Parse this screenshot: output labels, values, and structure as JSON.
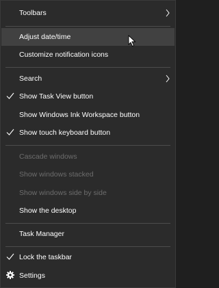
{
  "menu": {
    "toolbars": "Toolbars",
    "adjust_date_time": "Adjust date/time",
    "customize_notification_icons": "Customize notification icons",
    "search": "Search",
    "show_task_view": "Show Task View button",
    "show_ink_workspace": "Show Windows Ink Workspace button",
    "show_touch_keyboard": "Show touch keyboard button",
    "cascade_windows": "Cascade windows",
    "show_windows_stacked": "Show windows stacked",
    "show_windows_side_by_side": "Show windows side by side",
    "show_desktop": "Show the desktop",
    "task_manager": "Task Manager",
    "lock_taskbar": "Lock the taskbar",
    "settings": "Settings"
  },
  "checked": {
    "show_task_view": true,
    "show_touch_keyboard": true,
    "lock_taskbar": true
  },
  "colors": {
    "background": "#2b2b2b",
    "hover": "#414141",
    "text": "#ffffff",
    "disabled_text": "#6d6d6d",
    "separator": "#4d4d4d"
  },
  "icons": {
    "submenu": "chevron-right-icon",
    "checked": "checkmark-icon",
    "settings": "gear-icon",
    "pointer": "mouse-cursor-icon"
  }
}
